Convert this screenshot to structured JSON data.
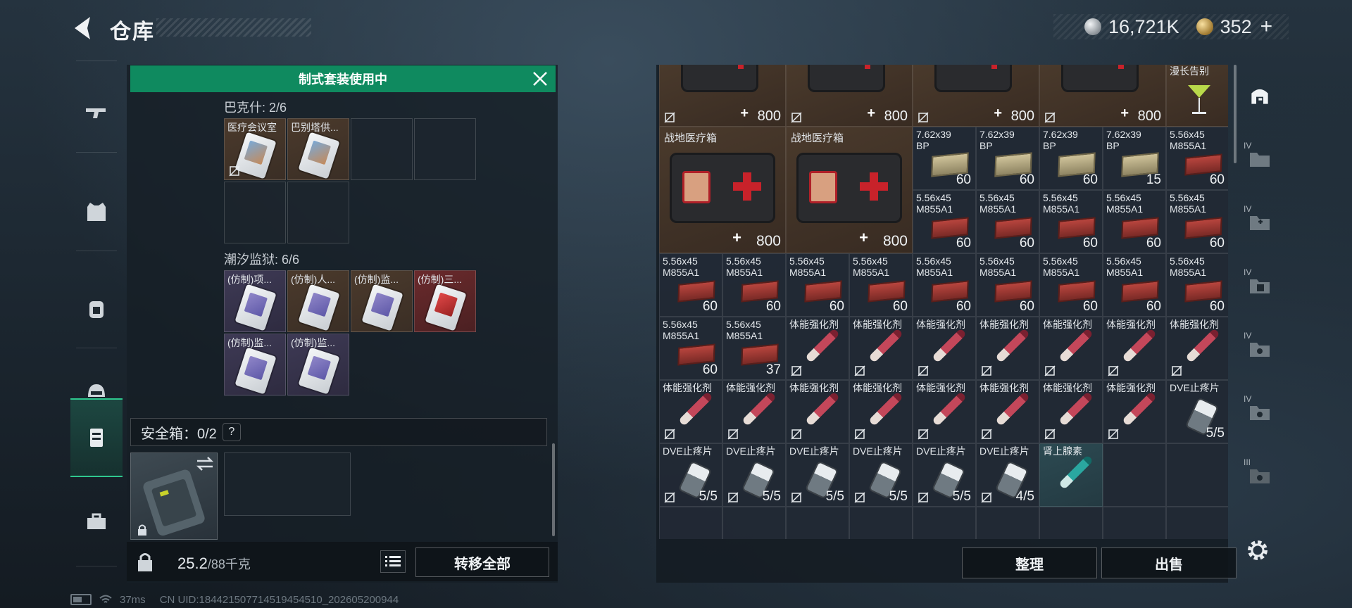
{
  "header": {
    "title": "仓库"
  },
  "currency": {
    "silver": "16,721K",
    "gold": "352",
    "gold_plus": "+"
  },
  "nav": {
    "icons": [
      "gun-icon",
      "vest-icon",
      "backpack-icon",
      "helmet-icon",
      "safe-case-icon",
      "toolbox-icon"
    ],
    "active": "safe-case-icon"
  },
  "loadout": {
    "banner": "制式套装使用中",
    "group1": {
      "label": "巴克什: 2/6",
      "items": [
        "医疗会议室",
        "巴别塔供..."
      ]
    },
    "group2": {
      "label": "潮汐监狱: 6/6",
      "items": [
        "(仿制)项...",
        "(仿制)人...",
        "(仿制)监...",
        "(仿制)三...",
        "(仿制)监...",
        "(仿制)监..."
      ]
    },
    "safe_label": "安全箱：0/2",
    "safe_help": "?",
    "weight_value": "25.2",
    "weight_max": "/88千克",
    "transfer_label": "转移全部"
  },
  "inventory": {
    "sort_label": "整理",
    "sell_label": "出售",
    "medkit_small": {
      "plus": "+",
      "value": "800"
    },
    "medkit_big": {
      "name": "战地医疗箱",
      "plus": "+",
      "value": "800"
    },
    "cocktail": {
      "name": "漫长告别"
    },
    "ammo_762": {
      "name": "7.62x39\nBP",
      "counts": [
        "60",
        "60",
        "60",
        "15"
      ]
    },
    "ammo_556": {
      "name": "5.56x45\nM855A1"
    },
    "counts_row1_end": "60",
    "row2_counts": [
      "60",
      "60",
      "60",
      "60",
      "60"
    ],
    "row3_counts": [
      "60",
      "60",
      "60",
      "60",
      "60",
      "60",
      "60",
      "60",
      "60"
    ],
    "row4_ammo_counts": [
      "60",
      "37"
    ],
    "stim": {
      "name": "体能强化剂"
    },
    "pain": {
      "name": "DVE止疼片",
      "counts": [
        "5/5",
        "5/5",
        "5/5",
        "5/5",
        "5/5",
        "5/5",
        "4/5"
      ]
    },
    "adrenaline": {
      "name": "肾上腺素"
    }
  },
  "storage_tabs": [
    "IV",
    "IV",
    "IV",
    "IV",
    "IV",
    "III"
  ],
  "status": {
    "ping": "37ms",
    "uid": "CN UID:184421507714519454510_202605200944"
  },
  "colors": {
    "accent_green": "#0f8a5f",
    "active_tab": "#2fc78e"
  }
}
